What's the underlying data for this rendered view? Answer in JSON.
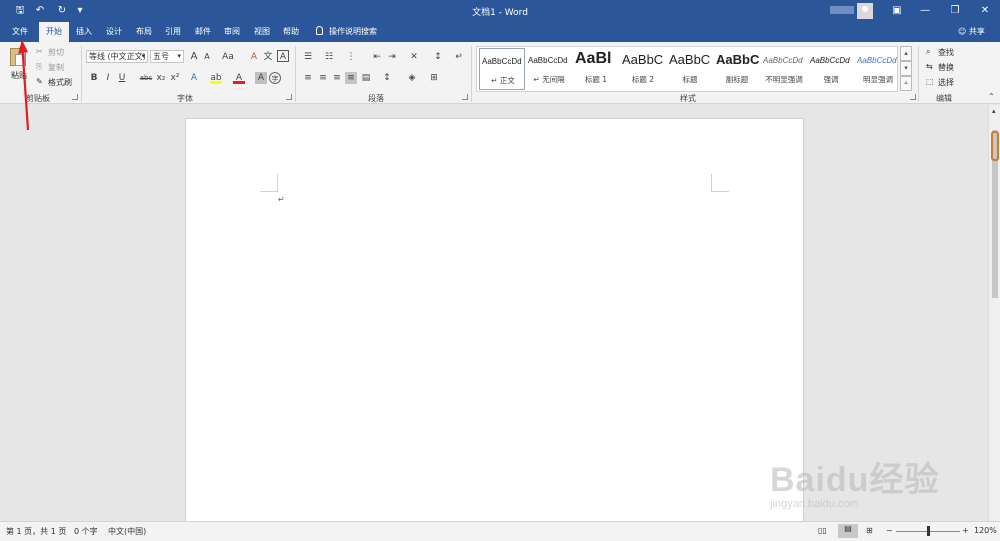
{
  "window": {
    "title": "文档1 - Word",
    "colors": {
      "accent": "#2b579a",
      "ribbon_bg": "#f3f3f3",
      "canvas_bg": "#e6e6e6",
      "annotation": "#e02020"
    },
    "quick_access": [
      {
        "icon": "save-icon",
        "glyph": "🖫"
      },
      {
        "icon": "undo-icon",
        "glyph": "↶"
      },
      {
        "icon": "redo-icon",
        "glyph": "↻"
      },
      {
        "icon": "customize-icon",
        "glyph": "▾"
      }
    ],
    "controls": [
      {
        "icon": "ribbon-display-icon",
        "glyph": "▣"
      },
      {
        "icon": "minimize-icon",
        "glyph": "—"
      },
      {
        "icon": "restore-icon",
        "glyph": "❐"
      },
      {
        "icon": "close-icon",
        "glyph": "✕"
      }
    ]
  },
  "tabs": [
    "文件",
    "开始",
    "插入",
    "设计",
    "布局",
    "引用",
    "邮件",
    "审阅",
    "视图",
    "帮助"
  ],
  "active_tab": "开始",
  "tell_me": "操作说明搜索",
  "share": "共享",
  "ribbon": {
    "clipboard": {
      "paste": "粘贴",
      "cut": "剪切",
      "copy": "复制",
      "format_painter": "格式刷",
      "label": "剪贴板"
    },
    "font": {
      "font_name": "等线 (中文正文)",
      "font_size": "五号",
      "grow": "A",
      "shrink": "A",
      "case": "Aa",
      "clear": "A",
      "phonetic": "文",
      "char_border": "A",
      "bold": "B",
      "italic": "I",
      "underline": "U",
      "strike": "abc",
      "subscript": "x₂",
      "superscript": "x²",
      "effects": "A",
      "highlight": "ab",
      "font_color": "A",
      "char_shading": "A",
      "enclose": "字",
      "label": "字体"
    },
    "paragraph": {
      "label": "段落"
    },
    "styles": {
      "label": "样式",
      "items": [
        {
          "sample": "AaBbCcDd",
          "name": "正文"
        },
        {
          "sample": "AaBbCcDd",
          "name": "无间隔"
        },
        {
          "sample": "AaBl",
          "name": "标题 1"
        },
        {
          "sample": "AaBbC",
          "name": "标题 2"
        },
        {
          "sample": "AaBbC",
          "name": "标题"
        },
        {
          "sample": "AaBbC",
          "name": "副标题"
        },
        {
          "sample": "AaBbCcDd",
          "name": "不明显强调"
        },
        {
          "sample": "AaBbCcDd",
          "name": "强调"
        },
        {
          "sample": "AaBbCcDd",
          "name": "明显强调"
        }
      ]
    },
    "editing": {
      "find": "查找",
      "replace": "替换",
      "select": "选择",
      "label": "编辑"
    }
  },
  "document": {
    "paragraph_mark": "↵"
  },
  "status": {
    "page": "第 1 页，共 1 页",
    "words": "0 个字",
    "language": "中文(中国)",
    "zoom": "120%",
    "zoom_minus": "−",
    "zoom_plus": "+",
    "zoom_level": 0.5
  },
  "watermark": {
    "logo": "Baidu经验",
    "url": "jingyan.baidu.com"
  }
}
